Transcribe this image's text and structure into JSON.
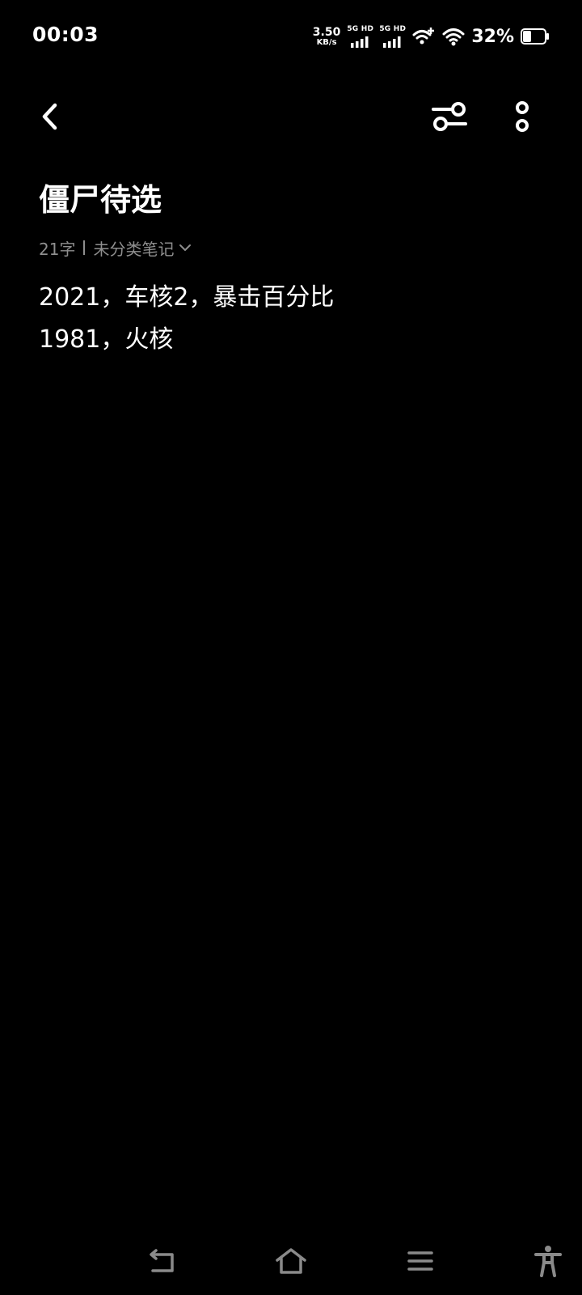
{
  "status_bar": {
    "time": "00:03",
    "net_speed_value": "3.50",
    "net_speed_unit": "KB/s",
    "sim1_label": "5G HD",
    "sim2_label": "5G HD",
    "battery_percent": "32%"
  },
  "toolbar": {
    "back_icon": "chevron-left-icon",
    "filter_icon": "sliders-icon",
    "more_icon": "more-vertical-icon"
  },
  "note": {
    "title": "僵尸待选",
    "word_count": "21字",
    "category": "未分类笔记",
    "lines": [
      "2021，车核2，暴击百分比",
      "1981，火核"
    ]
  },
  "nav_bar": {
    "back_icon": "nav-back-icon",
    "home_icon": "home-icon",
    "menu_icon": "menu-icon",
    "accessibility_icon": "accessibility-icon"
  },
  "colors": {
    "background": "#000000",
    "text": "#ffffff",
    "secondary_text": "#8e8e8e"
  }
}
